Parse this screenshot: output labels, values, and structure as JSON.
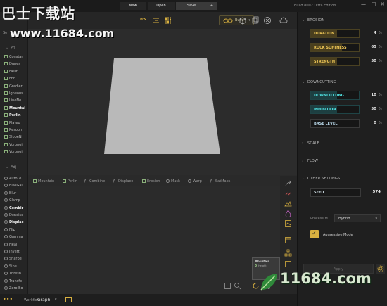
{
  "titlebar": {
    "new_label": "New",
    "open_label": "Open",
    "save_label": "Save",
    "plus_label": "+",
    "build_info": "Build 8002 Ultra Edition",
    "minimize": "—",
    "maximize": "□",
    "close": "✕"
  },
  "watermark": {
    "top_text": "巴士下载站",
    "url_text": "www.11684.com",
    "bottom_text": "11684.com"
  },
  "sidebar": {
    "search_label": "Se",
    "section_primitives": "Pri",
    "section_adjustments": "Adj",
    "primitives": [
      {
        "label": "Constar",
        "bold": false
      },
      {
        "label": "Dunes",
        "bold": false
      },
      {
        "label": "Fault",
        "bold": false
      },
      {
        "label": "Fbr",
        "bold": false
      },
      {
        "label": "Gradier",
        "bold": false
      },
      {
        "label": "Igneous",
        "bold": false
      },
      {
        "label": "LineNo",
        "bold": false
      },
      {
        "label": "Mountai",
        "bold": true
      },
      {
        "label": "Perlin",
        "bold": true
      },
      {
        "label": "Plateu",
        "bold": false
      },
      {
        "label": "Resoon",
        "bold": false
      },
      {
        "label": "SlopeN",
        "bold": false
      },
      {
        "label": "Voronoi",
        "bold": false
      },
      {
        "label": "Voronoi",
        "bold": false
      }
    ],
    "adjustments": [
      {
        "label": "AutoLe",
        "bold": false
      },
      {
        "label": "BiasGai",
        "bold": false
      },
      {
        "label": "Blur",
        "bold": false
      },
      {
        "label": "Clamp",
        "bold": false
      },
      {
        "label": "Combir",
        "bold": true
      },
      {
        "label": "Denoise",
        "bold": false
      },
      {
        "label": "Displac",
        "bold": true
      },
      {
        "label": "Flip",
        "bold": false
      },
      {
        "label": "Gamma",
        "bold": false
      },
      {
        "label": "Heal",
        "bold": false
      },
      {
        "label": "Invert",
        "bold": false
      },
      {
        "label": "Sharpe",
        "bold": false
      },
      {
        "label": "Sine",
        "bold": false
      },
      {
        "label": "Thresh",
        "bold": false
      },
      {
        "label": "Transfo",
        "bold": false
      },
      {
        "label": "Zero Bo",
        "bold": false
      }
    ]
  },
  "toolbar": {
    "build_label": "Build",
    "build_dropdown": "▾"
  },
  "nodebar": {
    "items": [
      {
        "label": "Mountain",
        "kind": "square"
      },
      {
        "label": "Perlin",
        "kind": "square"
      },
      {
        "label": "Combine",
        "kind": "slash"
      },
      {
        "label": "Displace",
        "kind": "slash"
      },
      {
        "label": "Erosion",
        "kind": "square"
      },
      {
        "label": "Mask",
        "kind": "circle"
      },
      {
        "label": "Warp",
        "kind": "circle"
      },
      {
        "label": "SatMaps",
        "kind": "slash"
      }
    ]
  },
  "graph": {
    "node_title": "Mountain",
    "node_port": "Height"
  },
  "statusbar": {
    "dots": "•••",
    "workflow_label": "Workflow",
    "graph_label": "Graph",
    "dropdown": "▾"
  },
  "rpanel": {
    "erosion_title": "EROSION",
    "erosion_params": [
      {
        "label": "DURATION",
        "value": "4",
        "unit": "%",
        "fill": 0.04
      },
      {
        "label": "ROCK SOFTNESS",
        "value": "65",
        "unit": "%",
        "fill": 0.65
      },
      {
        "label": "STRENGTH",
        "value": "50",
        "unit": "%",
        "fill": 0.5
      }
    ],
    "downcutting_title": "DOWNCUTTING",
    "downcutting_params": [
      {
        "label": "DOWNCUTTING",
        "value": "10",
        "unit": "%",
        "fill": 0.1
      },
      {
        "label": "INHIBITION",
        "value": "50",
        "unit": "%",
        "fill": 0.5
      },
      {
        "label": "BASE LEVEL",
        "value": "0",
        "unit": "%",
        "fill": 0
      }
    ],
    "scale_title": "SCALE",
    "flow_title": "FLOW",
    "other_title": "OTHER SETTINGS",
    "seed_label": "SEED",
    "seed_value": "574",
    "process_label": "Process M",
    "process_value": "Hybrid",
    "process_dropdown": "▾",
    "aggressive_label": "Aggressive Mode",
    "aggressive_checked": "✓",
    "apply_label": "Apply"
  },
  "colors": {
    "accent_gold": "#d8b040",
    "erosion_label": "#f0c857",
    "downcutting_label": "#4fe0e0",
    "terrain_plane": "#b9b9b9"
  }
}
